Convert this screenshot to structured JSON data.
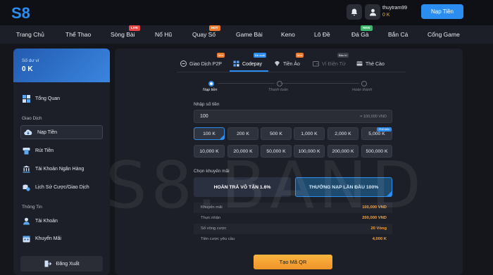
{
  "header": {
    "logo_text": "S8",
    "username": "thuytram99",
    "balance": "0 K",
    "deposit_button": "Nạp Tiền"
  },
  "nav": {
    "items": [
      {
        "label": "Trang Chủ"
      },
      {
        "label": "Thể Thao"
      },
      {
        "label": "Sòng Bài",
        "badge": "LIVE"
      },
      {
        "label": "Nổ Hũ"
      },
      {
        "label": "Quay Số",
        "badge": "HOT"
      },
      {
        "label": "Game Bài"
      },
      {
        "label": "Keno"
      },
      {
        "label": "Lô Đề"
      },
      {
        "label": "Đá Gà",
        "badge": "NEW"
      },
      {
        "label": "Bắn Cá"
      },
      {
        "label": "Cổng Game"
      }
    ]
  },
  "sidebar": {
    "balance_label": "Số dư ví",
    "balance_value": "0 K",
    "overview": "Tổng Quan",
    "section_transactions": "Giao Dịch",
    "deposit": "Nạp Tiền",
    "withdraw": "Rút Tiền",
    "bank_accounts": "Tài Khoản Ngân Hàng",
    "history": "Lịch Sử Cược/Giao Dịch",
    "section_info": "Thông Tin",
    "account": "Tài Khoản",
    "promotions": "Khuyến Mãi",
    "logout": "Đăng Xuất"
  },
  "tabs": {
    "p2p": "Giao Dịch P2P",
    "p2p_badge": "Mới",
    "codepay": "Codepay",
    "codepay_badge": "Đề xuất",
    "crypto": "Tiền Ảo",
    "crypto_badge": "Mới",
    "ewallet": "Ví Điện Tử",
    "ewallet_badge": "Bảo trì",
    "card": "Thẻ Cào"
  },
  "steps": [
    "Nạp tiền",
    "Thanh toán",
    "Hoàn thành"
  ],
  "form": {
    "amount_label": "Nhập số tiền",
    "amount_value": "100",
    "amount_hint": "= 100,000 VND",
    "amount_options": [
      "100 K",
      "200 K",
      "500 K",
      "1,000 K",
      "2,000 K",
      "5,000 K",
      "10,000 K",
      "20,000 K",
      "50,000 K",
      "100,000 K",
      "200,000 K",
      "500,000 K"
    ],
    "selected_amount": "100 K",
    "option_tag": "Phổ biến",
    "promo_label": "Chọn khuyến mãi",
    "promo_a": "HOÀN TRẢ VÔ TẬN 1.6%",
    "promo_b": "THƯỞNG NẠP LẦN ĐẦU 100%"
  },
  "summary": [
    {
      "key": "Khuyến mãi",
      "value": "100,000 VND"
    },
    {
      "key": "Thực nhận",
      "value": "200,000 VND"
    },
    {
      "key": "Số vòng cược",
      "value": "20 Vòng"
    },
    {
      "key": "Tiền cược yêu cầu",
      "value": "4,000 K"
    }
  ],
  "qr_button": "Tạo Mã QR",
  "watermark": "S8.BAND",
  "colors": {
    "accent": "#2b8df0",
    "orange": "#f5a33b",
    "background": "#14161c"
  }
}
